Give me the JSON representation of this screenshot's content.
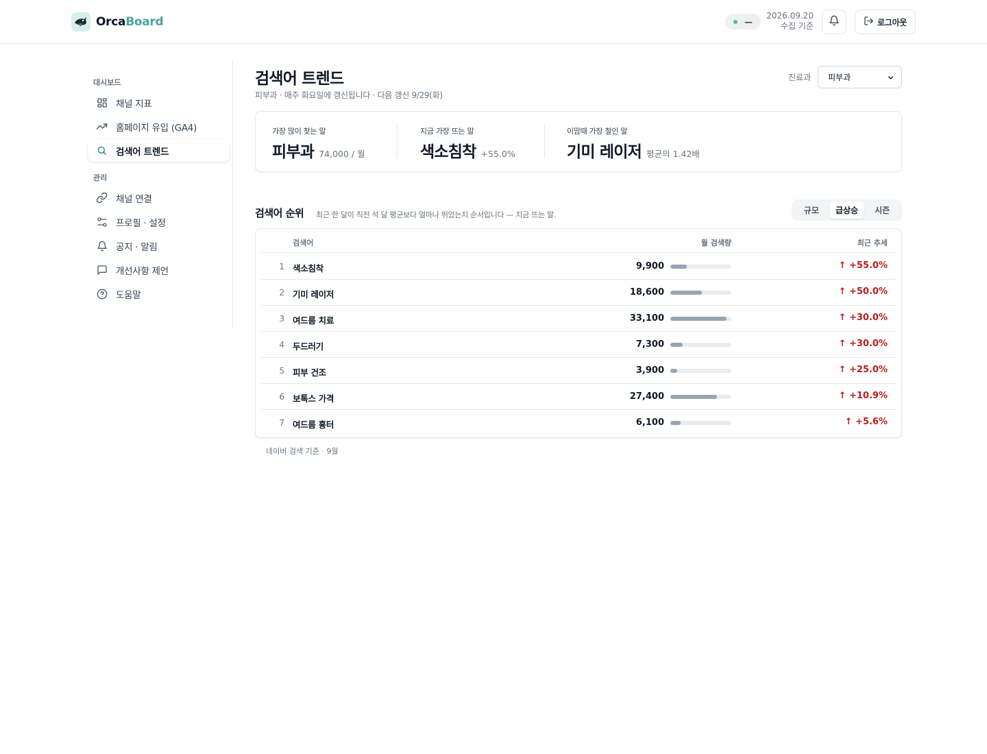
{
  "header": {
    "brand_part1": "Orca",
    "brand_part2": "Board",
    "status_text": "—",
    "collect_date": "2026.09.20",
    "collect_label": "수집 기준",
    "logout_label": "로그아웃"
  },
  "sidebar": {
    "section_dashboard": "대시보드",
    "section_manage": "관리",
    "items": [
      {
        "label": "채널 지표",
        "icon": "grid-icon"
      },
      {
        "label": "홈페이지 유입 (GA4)",
        "icon": "trending-up-icon"
      },
      {
        "label": "검색어 트렌드",
        "icon": "search-icon",
        "active": true
      },
      {
        "label": "채널 연결",
        "icon": "link-icon"
      },
      {
        "label": "프로필 · 설정",
        "icon": "sliders-icon"
      },
      {
        "label": "공지 · 알림",
        "icon": "bell-icon"
      },
      {
        "label": "개선사항 제언",
        "icon": "message-icon"
      },
      {
        "label": "도움말",
        "icon": "help-circle-icon"
      }
    ]
  },
  "main": {
    "title": "검색어 트렌드",
    "subtitle": "피부과 · 매주 화요일에 갱신됩니다 · 다음 갱신 9/29(화)",
    "dept_label": "진료과",
    "dept_value": "피부과"
  },
  "summary": [
    {
      "label": "가장 많이 찾는 말",
      "value": "피부과",
      "detail": "74,000 / 월"
    },
    {
      "label": "지금 가장 뜨는 말",
      "value": "색소침착",
      "detail": "+55.0%"
    },
    {
      "label": "이맘때 가장 철인 말",
      "value": "기미 레이저",
      "detail": "평균의 1.42배"
    }
  ],
  "ranking": {
    "title": "검색어 순위",
    "description": "최근 한 달이 직전 석 달 평균보다 얼마나 뛰었는지 순서입니다 — 지금 뜨는 말.",
    "tabs": [
      "규모",
      "급상승",
      "시즌"
    ],
    "active_tab": "급상승",
    "columns": {
      "term": "검색어",
      "volume": "월 검색량",
      "trend": "최근 추세"
    },
    "max_volume": 36000,
    "rows": [
      {
        "rank": "1",
        "term": "색소침착",
        "volume": 9900,
        "volume_text": "9,900",
        "trend": "↑ +55.0%"
      },
      {
        "rank": "2",
        "term": "기미 레이저",
        "volume": 18600,
        "volume_text": "18,600",
        "trend": "↑ +50.0%"
      },
      {
        "rank": "3",
        "term": "여드름 치료",
        "volume": 33100,
        "volume_text": "33,100",
        "trend": "↑ +30.0%"
      },
      {
        "rank": "4",
        "term": "두드러기",
        "volume": 7300,
        "volume_text": "7,300",
        "trend": "↑ +30.0%"
      },
      {
        "rank": "5",
        "term": "피부 건조",
        "volume": 3900,
        "volume_text": "3,900",
        "trend": "↑ +25.0%"
      },
      {
        "rank": "6",
        "term": "보톡스 가격",
        "volume": 27400,
        "volume_text": "27,400",
        "trend": "↑ +10.9%"
      },
      {
        "rank": "7",
        "term": "여드름 흉터",
        "volume": 6100,
        "volume_text": "6,100",
        "trend": "↑ +5.6%"
      }
    ],
    "footnote": "네이버 검색 기준 · 9월"
  },
  "colors": {
    "accent": "#4aa69a",
    "trend_up": "#b91c1c",
    "status_online": "#3ecf6e",
    "bar_fill": "#9aa3b2"
  }
}
